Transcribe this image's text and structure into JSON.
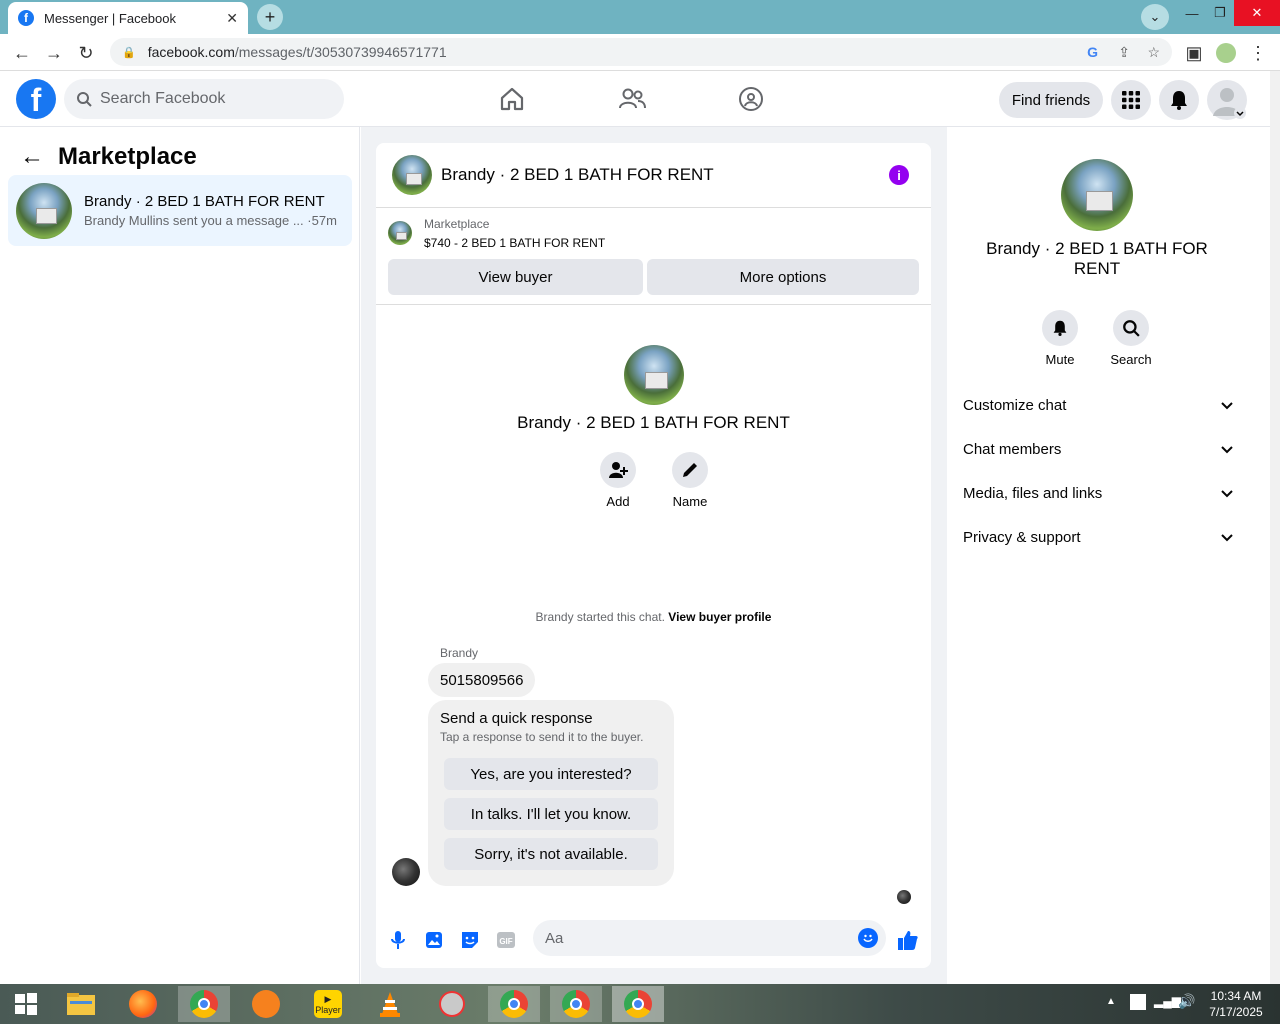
{
  "browser": {
    "tab_title": "Messenger | Facebook",
    "url_host": "facebook.com",
    "url_path": "/messages/t/30530739946571771"
  },
  "header": {
    "search_placeholder": "Search Facebook",
    "find_friends": "Find friends"
  },
  "left": {
    "title": "Marketplace",
    "conversation": {
      "name": "Brandy · 2 BED 1 BATH FOR RENT",
      "snippet": "Brandy Mullins sent you a message ...",
      "time": "·57m"
    }
  },
  "chat": {
    "title": "Brandy · 2 BED 1 BATH FOR RENT",
    "marketplace_label": "Marketplace",
    "listing": "$740 - 2 BED 1 BATH FOR RENT",
    "view_buyer": "View buyer",
    "more_options": "More options",
    "center_name": "Brandy · 2 BED 1 BATH FOR RENT",
    "add_label": "Add",
    "name_label": "Name",
    "started_text": "Brandy started this chat.",
    "view_buyer_profile": "View buyer profile",
    "sender": "Brandy",
    "message": "5015809566",
    "quick_title": "Send a quick response",
    "quick_sub": "Tap a response to send it to the buyer.",
    "quick_responses": [
      "Yes, are you interested?",
      "In talks. I'll let you know.",
      "Sorry, it's not available."
    ],
    "input_placeholder": "Aa"
  },
  "right": {
    "name": "Brandy · 2 BED 1 BATH FOR RENT",
    "mute": "Mute",
    "search": "Search",
    "sections": [
      "Customize chat",
      "Chat members",
      "Media, files and links",
      "Privacy & support"
    ]
  },
  "taskbar": {
    "time": "10:34 AM",
    "date": "7/17/2025",
    "player_label": "Player"
  },
  "colors": {
    "fb_blue": "#1877f2",
    "accent_purple": "#9400f0",
    "tab_bar": "#6fb3c1"
  }
}
